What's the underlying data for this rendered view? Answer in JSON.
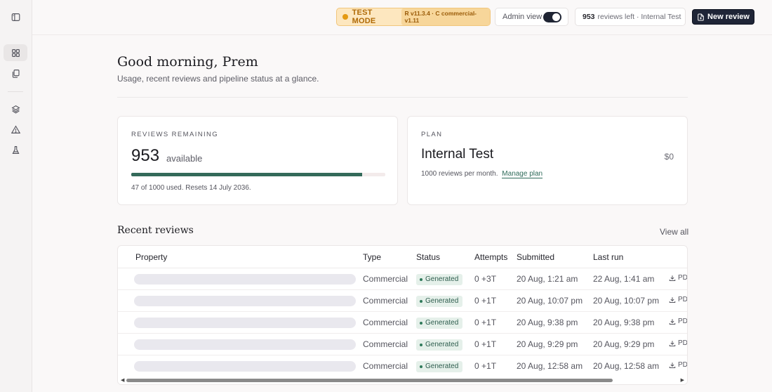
{
  "topbar": {
    "test_mode_label": "TEST MODE",
    "version": "R v11.3.4 · C commercial-v1.11",
    "admin_view_label": "Admin view",
    "admin_view_on": true,
    "reviews_left_count": "953",
    "reviews_left_text": "reviews left · Internal Test",
    "new_review_label": "New review"
  },
  "header": {
    "greeting": "Good morning, Prem",
    "subtitle": "Usage, recent reviews and pipeline status at a glance."
  },
  "reviews_card": {
    "kicker": "REVIEWS REMAINING",
    "count": "953",
    "count_suffix": "available",
    "usage_fraction": 0.91,
    "usage_text": "47 of 1000 used. Resets 14 July 2036."
  },
  "plan_card": {
    "kicker": "PLAN",
    "name": "Internal Test",
    "price": "$0",
    "description": "1000 reviews per month.",
    "manage_label": "Manage plan"
  },
  "recent": {
    "title": "Recent reviews",
    "view_all": "View all",
    "columns": [
      "Property",
      "Type",
      "Status",
      "Attempts",
      "Submitted",
      "Last run"
    ],
    "rows": [
      {
        "type": "Commercial",
        "status": "Generated",
        "attempts": "0 +3T",
        "submitted": "20 Aug, 1:21 am",
        "last_run": "22 Aug, 1:41 am",
        "action": "PD"
      },
      {
        "type": "Commercial",
        "status": "Generated",
        "attempts": "0 +1T",
        "submitted": "20 Aug, 10:07 pm",
        "last_run": "20 Aug, 10:07 pm",
        "action": "PD"
      },
      {
        "type": "Commercial",
        "status": "Generated",
        "attempts": "0 +1T",
        "submitted": "20 Aug, 9:38 pm",
        "last_run": "20 Aug, 9:38 pm",
        "action": "PD"
      },
      {
        "type": "Commercial",
        "status": "Generated",
        "attempts": "0 +1T",
        "submitted": "20 Aug, 9:29 pm",
        "last_run": "20 Aug, 9:29 pm",
        "action": "PD"
      },
      {
        "type": "Commercial",
        "status": "Generated",
        "attempts": "0 +1T",
        "submitted": "20 Aug, 12:58 am",
        "last_run": "20 Aug, 12:58 am",
        "action": "PD"
      }
    ]
  },
  "sidebar": {
    "icons": [
      "panel-toggle-icon",
      "dashboard-grid-icon",
      "documents-icon",
      "layers-icon",
      "warning-icon",
      "flask-icon"
    ]
  },
  "colors": {
    "accent": "#346a5a",
    "test_mode_bg": "#fde7bf",
    "primary_button": "#1f2537"
  }
}
